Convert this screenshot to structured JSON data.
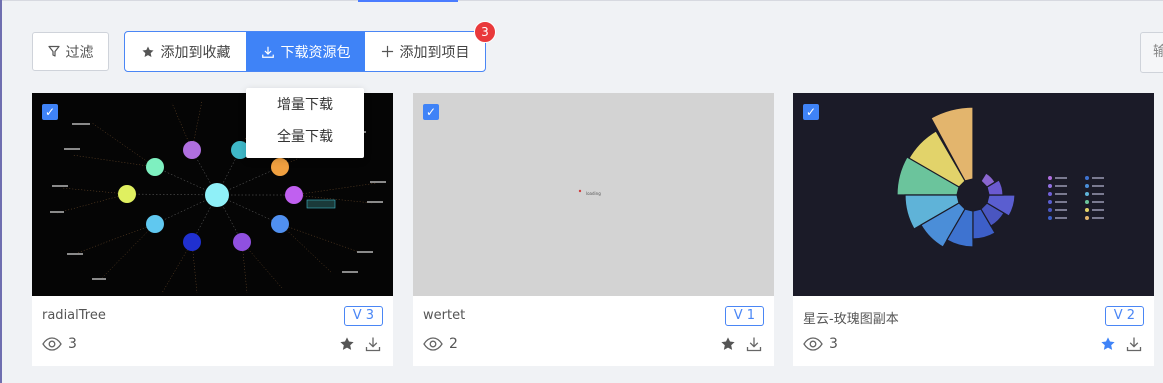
{
  "toolbar": {
    "filter_label": "过滤",
    "add_favorite_label": "添加到收藏",
    "download_pack_label": "下载资源包",
    "add_project_label": "添加到项目",
    "badge_count": "3",
    "right_button_partial": "输"
  },
  "dropdown": {
    "items": [
      "增量下载",
      "全量下载"
    ]
  },
  "cards": [
    {
      "title": "radialTree",
      "version": "V 3",
      "views": "3",
      "checked": true,
      "favorited": true,
      "favorite_color": "#555555"
    },
    {
      "title": "wertet",
      "version": "V 1",
      "views": "2",
      "checked": true,
      "favorited": true,
      "favorite_color": "#555555",
      "loading_text": "loading"
    },
    {
      "title": "星云-玫瑰图副本",
      "version": "V 2",
      "views": "3",
      "checked": true,
      "favorited": true,
      "favorite_color": "#3f83f7"
    }
  ],
  "colors": {
    "accent": "#3f83f7",
    "badge": "#e9393b",
    "page_bg": "#f0f2f5"
  }
}
